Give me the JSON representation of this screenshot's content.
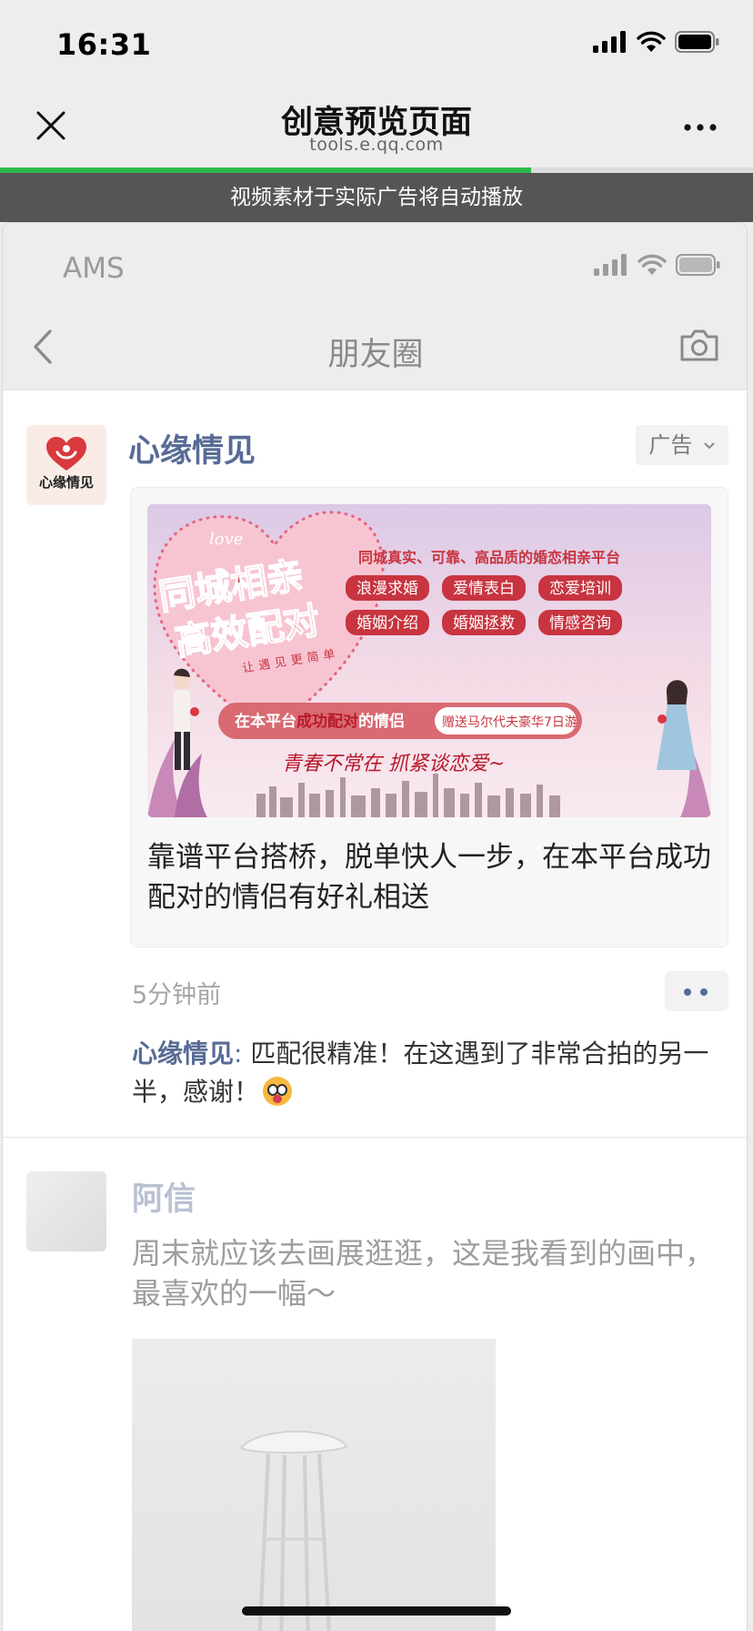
{
  "status_bar": {
    "time": "16:31"
  },
  "browser_nav": {
    "title": "创意预览页面",
    "subtitle": "tools.e.qq.com",
    "load_progress": 0.705
  },
  "banner": {
    "text": "视频素材于实际广告将自动播放"
  },
  "preview_status": {
    "carrier": "AMS"
  },
  "preview_nav": {
    "title": "朋友圈"
  },
  "ad_post": {
    "poster_name": "心缘情见",
    "avatar_text": "心缘情见",
    "ad_label": "广告",
    "image": {
      "love_word": "love",
      "headline_1": "同城相亲",
      "headline_2": "高效配对",
      "tagline": "让遇见更简单",
      "platform_line": "同城真实、可靠、高品质的婚恋相亲平台",
      "services": [
        "浪漫求婚",
        "爱情表白",
        "恋爱培训",
        "婚姻介绍",
        "婚姻拯救",
        "情感咨询"
      ],
      "promo_prefix": "在本平台",
      "promo_highlight": "成功配对",
      "promo_suffix": "的情侣",
      "promo_gift": "赠送马尔代夫豪华7日游",
      "slogan": "青春不常在  抓紧谈恋爱~"
    },
    "caption": "靠谱平台搭桥，脱单快人一步，在本平台成功配对的情侣有好礼相送",
    "time": "5分钟前",
    "comment": {
      "author": "心缘情见",
      "separator": ": ",
      "text": "匹配很精准！在这遇到了非常合拍的另一半，感谢！"
    }
  },
  "second_post": {
    "name": "阿信",
    "text": "周末就应该去画展逛逛，这是我看到的画中，最喜欢的一幅～"
  },
  "colors": {
    "link_blue": "#576b95",
    "progress_green": "#2fb84a",
    "banner_gray": "#555555",
    "ad_red": "#c8343f"
  }
}
